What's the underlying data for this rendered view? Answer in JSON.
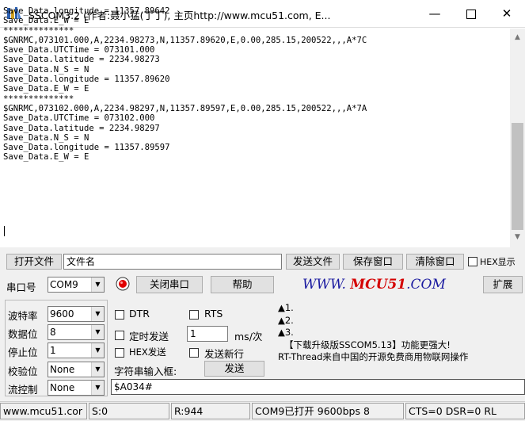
{
  "window": {
    "title": "SSCOM3.2 (作者:聂小猛(丁丁), 主页http://www.mcu51.com,  E...",
    "minimize": "—",
    "close": "✕"
  },
  "receive": {
    "lines": [
      "Save_Data.longitude = 11357.89642",
      "Save_Data.E_W = E",
      "**************",
      "$GNRMC,073101.000,A,2234.98273,N,11357.89620,E,0.00,285.15,200522,,,A*7C",
      "Save_Data.UTCTime = 073101.000",
      "Save_Data.latitude = 2234.98273",
      "Save_Data.N_S = N",
      "Save_Data.longitude = 11357.89620",
      "Save_Data.E_W = E",
      "**************",
      "$GNRMC,073102.000,A,2234.98297,N,11357.89597,E,0.00,285.15,200522,,,A*7A",
      "Save_Data.UTCTime = 073102.000",
      "Save_Data.latitude = 2234.98297",
      "Save_Data.N_S = N",
      "Save_Data.longitude = 11357.89597",
      "Save_Data.E_W = E"
    ]
  },
  "file_row": {
    "open_file": "打开文件",
    "filename": "文件名",
    "send_file": "发送文件",
    "save_window": "保存窗口",
    "clear_window": "清除窗口",
    "hex_display": "HEX显示"
  },
  "port_row": {
    "port_label": "串口号",
    "port_value": "COM9",
    "close_port": "关闭串口",
    "help": "帮助",
    "brand_prefix": "WWW.",
    "brand_main": "MCU51",
    "brand_suffix": ".COM",
    "expand": "扩展"
  },
  "settings": {
    "baud_label": "波特率",
    "baud_value": "9600",
    "data_label": "数据位",
    "data_value": "8",
    "stop_label": "停止位",
    "stop_value": "1",
    "parity_label": "校验位",
    "parity_value": "None",
    "flow_label": "流控制",
    "flow_value": "None"
  },
  "options": {
    "dtr": "DTR",
    "rts": "RTS",
    "timed_send": "定时发送",
    "interval_value": "1",
    "interval_unit": "ms/次",
    "hex_send": "HEX发送",
    "send_newline": "发送新行",
    "string_input_label": "字符串输入框:",
    "send": "发送",
    "input_value": "$A034#"
  },
  "info": {
    "line1": "▲1.",
    "line2": "▲2.",
    "line3": "▲3.",
    "line4": "【下载升级版SSCOM5.13】功能更强大!",
    "line5": "RT-Thread来自中国的开源免费商用物联网操作"
  },
  "status": {
    "site": "www.mcu51.cor",
    "sent": "S:0",
    "received": "R:944",
    "port_state": "COM9已打开  9600bps  8",
    "signals": "CTS=0 DSR=0 RL"
  },
  "colors": {
    "brand_blue": "#1a1aa0",
    "brand_red": "#d40000"
  }
}
